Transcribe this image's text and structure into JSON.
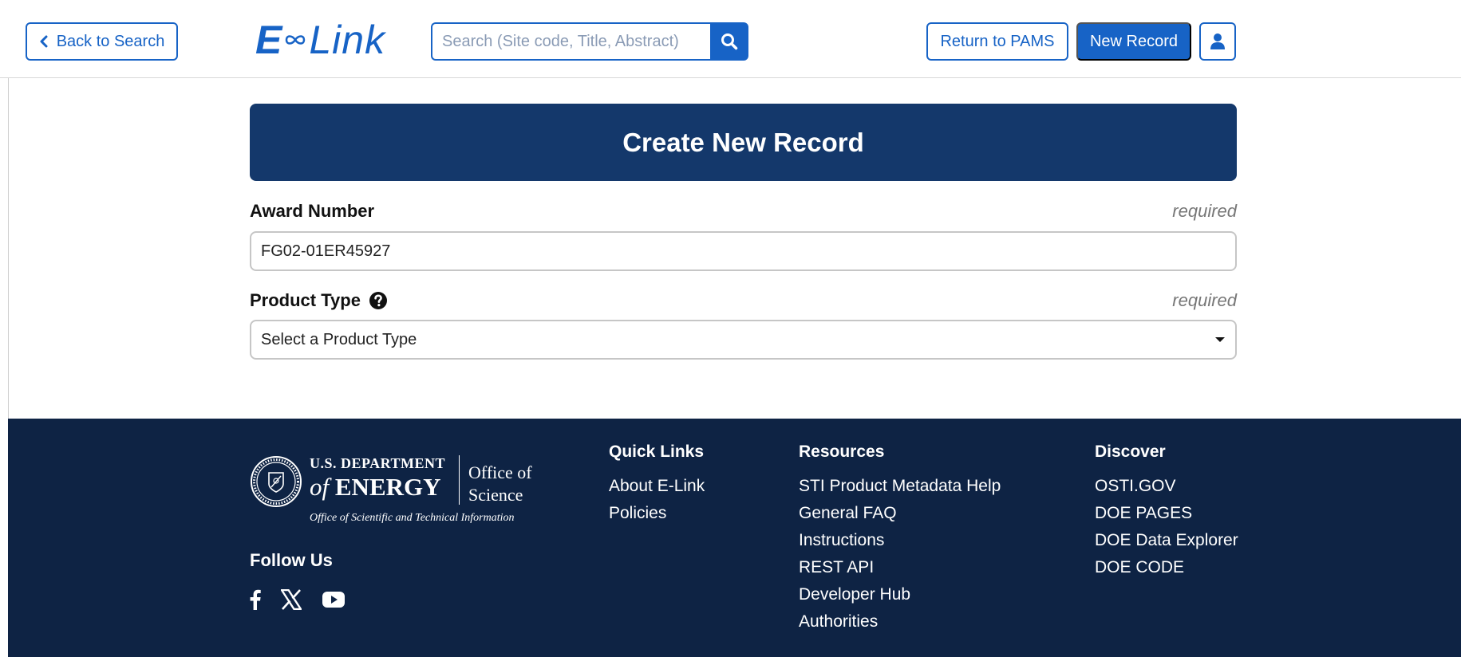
{
  "header": {
    "back_label": "Back to Search",
    "logo_e": "E",
    "logo_link": "Link",
    "search_placeholder": "Search (Site code, Title, Abstract)",
    "return_label": "Return to PAMS",
    "new_record_label": "New Record",
    "accent_color": "#1763c6"
  },
  "main": {
    "title": "Create New Record",
    "banner_color": "#14386b",
    "award_label": "Award Number",
    "award_required": "required",
    "award_value": "FG02-01ER45927",
    "product_label": "Product Type",
    "product_required": "required",
    "product_selected": "Select a Product Type"
  },
  "footer": {
    "background_color": "#0e2344",
    "doe_dept": "U.S. DEPARTMENT",
    "doe_of": "of",
    "doe_energy": "ENERGY",
    "doe_office_line1": "Office of",
    "doe_office_line2": "Science",
    "doe_osti": "Office of Scientific and Technical Information",
    "follow_title": "Follow Us",
    "social_icons": [
      "facebook-icon",
      "x-icon",
      "youtube-icon"
    ],
    "quick_links": {
      "title": "Quick Links",
      "items": [
        "About E-Link",
        "Policies"
      ]
    },
    "resources": {
      "title": "Resources",
      "items": [
        "STI Product Metadata Help",
        "General FAQ",
        "Instructions",
        "REST API",
        "Developer Hub",
        "Authorities"
      ]
    },
    "discover": {
      "title": "Discover",
      "items": [
        "OSTI.GOV",
        "DOE PAGES",
        "DOE Data Explorer",
        "DOE CODE"
      ]
    }
  }
}
